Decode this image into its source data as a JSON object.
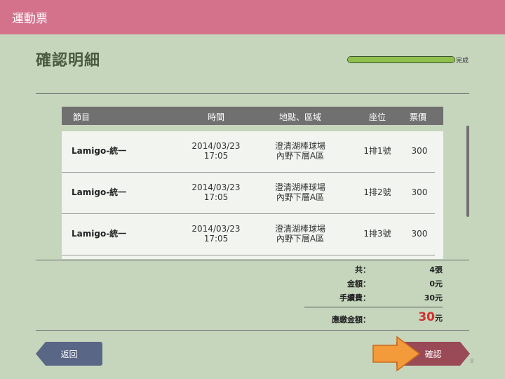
{
  "app": {
    "title": "運動票"
  },
  "page": {
    "title": "確認明細",
    "number": "8"
  },
  "progress": {
    "label": "完成",
    "fraction": 1.0
  },
  "table": {
    "columns": [
      "節目",
      "時間",
      "地點、區域",
      "座位",
      "票價"
    ],
    "rows": [
      {
        "event": "Lamigo-統一",
        "date": "2014/03/23",
        "time": "17:05",
        "venue": "澄清湖棒球場",
        "area": "內野下層A區",
        "seat": "1排1號",
        "price": "300"
      },
      {
        "event": "Lamigo-統一",
        "date": "2014/03/23",
        "time": "17:05",
        "venue": "澄清湖棒球場",
        "area": "內野下層A區",
        "seat": "1排2號",
        "price": "300"
      },
      {
        "event": "Lamigo-統一",
        "date": "2014/03/23",
        "time": "17:05",
        "venue": "澄清湖棒球場",
        "area": "內野下層A區",
        "seat": "1排3號",
        "price": "300"
      }
    ]
  },
  "summary": {
    "count_label": "共：",
    "count_value": "4張",
    "amount_label": "金額：",
    "amount_value": "0元",
    "fee_label": "手續費：",
    "fee_value": "30元",
    "total_label": "應繳金額：",
    "total_number": "30",
    "total_unit": "元"
  },
  "buttons": {
    "back": "返回",
    "confirm": "確認"
  },
  "colors": {
    "topbar": "#d4728c",
    "background": "#c5d6bd",
    "back_button": "#5a6686",
    "confirm_button": "#9a4a56",
    "highlight_arrow": "#f39a3a",
    "total_amount": "#d43030"
  }
}
